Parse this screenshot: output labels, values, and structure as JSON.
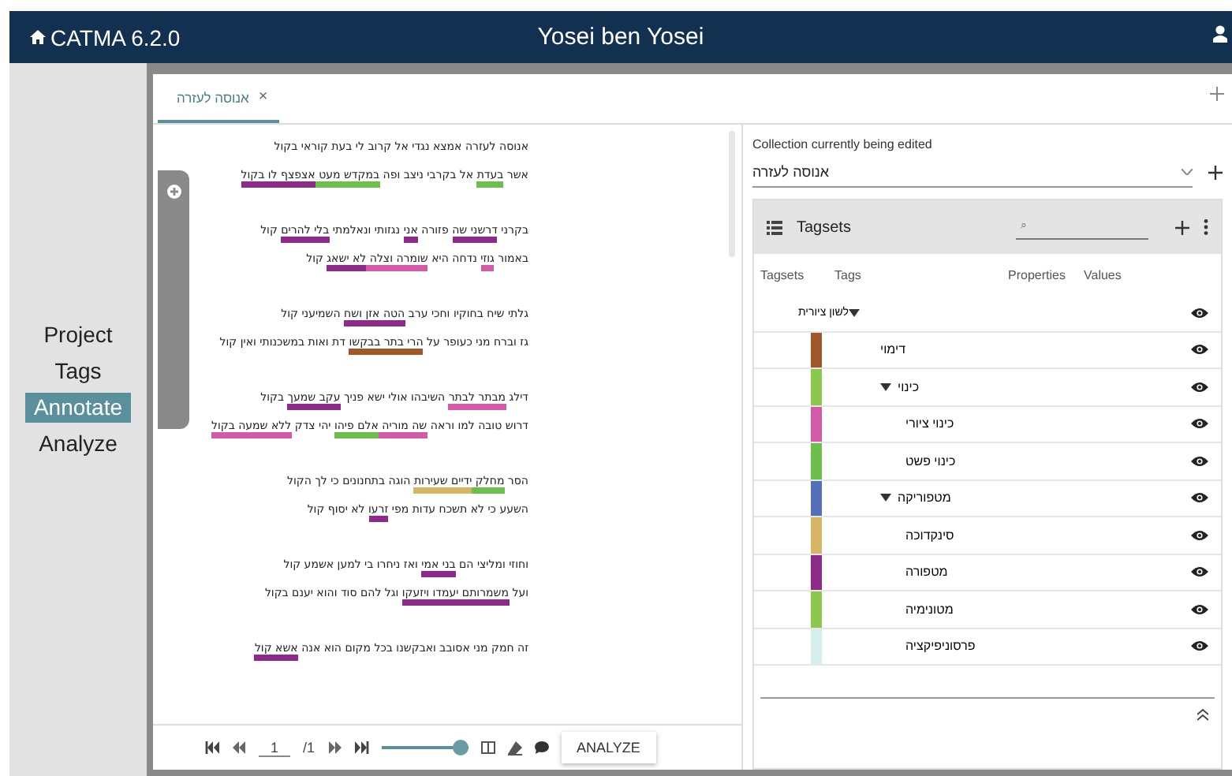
{
  "header": {
    "app": "CATMA 6.2.0",
    "user": "Yosei ben Yosei"
  },
  "nav": [
    {
      "label": "Project",
      "selected": false
    },
    {
      "label": "Tags",
      "selected": false
    },
    {
      "label": "Annotate",
      "selected": true
    },
    {
      "label": "Analyze",
      "selected": false
    }
  ],
  "tabs": [
    {
      "label": "אנוסה לעזרה",
      "close": "×",
      "selected": true
    }
  ],
  "document": {
    "stanzas": [
      [
        [
          {
            "text": "אנוסה לעזרה אמצא נגדי אל קרוב לי בעת קוראי בקול"
          }
        ],
        [
          {
            "text": "אשר "
          },
          {
            "text": "בעדת",
            "color": "#6cbf4a"
          },
          {
            "text": " אל בקרבי ניצב ופה "
          },
          {
            "text": "במקדש מעט ",
            "color": "#6cbf4a"
          },
          {
            "text": "אצפצף לו בקול",
            "color": "#8e2a8a"
          }
        ]
      ],
      [
        [
          {
            "text": "בקרני "
          },
          {
            "text": "דרשני שה",
            "color": "#8e2a8a"
          },
          {
            "text": " פזורה "
          },
          {
            "text": "אני",
            "color": "#8e2a8a"
          },
          {
            "text": " נגזותי ונאלמתי "
          },
          {
            "text": "בלי להרים",
            "color": "#8e2a8a"
          },
          {
            "text": " קול"
          }
        ],
        [
          {
            "text": "באמור "
          },
          {
            "text": "גוזי",
            "color": "#d45aa8"
          },
          {
            "text": " נדחה היא "
          },
          {
            "text": "שומרה וצלה ",
            "color": "#d45aa8"
          },
          {
            "text": "לא ישאג",
            "color": "#8e2a8a"
          },
          {
            "text": " קול"
          }
        ]
      ],
      [
        [
          {
            "text": "גלתי שיח בחוקיו וחכי ערב "
          },
          {
            "text": "הטה אזן ",
            "color": "#8e2a8a"
          },
          {
            "text": "ושח",
            "color": "#8e2a8a"
          },
          {
            "text": " השמיעני קול"
          }
        ],
        [
          {
            "text": "גז וברח מני כעופר על "
          },
          {
            "text": "הרי בתר בבקשו",
            "color": "#a0582a"
          },
          {
            "text": " דת ואות במשכנותי ואין קול"
          }
        ]
      ],
      [
        [
          {
            "text": "דילג "
          },
          {
            "text": "מבתר לבתר",
            "color": "#d45aa8"
          },
          {
            "text": " השיבהו אולי ישא פניך "
          },
          {
            "text": "עקב שמעך",
            "color": "#8e2a8a"
          },
          {
            "text": " בקול"
          }
        ],
        [
          {
            "text": "דרוש טובה למו וראה "
          },
          {
            "text": "שה מוריה ",
            "color": "#d45aa8"
          },
          {
            "text": "אלם פיהו",
            "color": "#6cbf4a"
          },
          {
            "text": " יהי צדק "
          },
          {
            "text": "ללא שמעה בקול",
            "color": "#d45aa8"
          }
        ]
      ],
      [
        [
          {
            "text": "הסר "
          },
          {
            "text": "מחלק ",
            "color": "#6cbf4a"
          },
          {
            "text": "ידיים שעירות",
            "color": "#d6b565"
          },
          {
            "text": " הוגה בתחנונים כי לך הקול"
          }
        ],
        [
          {
            "text": "השעע כי לא תשכח עדות מפי "
          },
          {
            "text": "זרעו",
            "color": "#8e2a8a"
          },
          {
            "text": " לא יסוף קול"
          }
        ]
      ],
      [
        [
          {
            "text": "וחוזי ומליצי הם "
          },
          {
            "text": "בני אמי",
            "color": "#8e2a8a"
          },
          {
            "text": " ואז ניחרו בי למען אשמע קול"
          }
        ],
        [
          {
            "text": "ועל "
          },
          {
            "text": "משמרותם יעמדו ויזעקו",
            "color": "#8e2a8a"
          },
          {
            "text": " וגל להם סוד והוא יענם בקול"
          }
        ]
      ],
      [
        [
          {
            "text": "זה חמק מני אסובב ואבקשנו בכל מקום הוא אנה "
          },
          {
            "text": "אשא קול",
            "color": "#8e2a8a"
          }
        ]
      ]
    ],
    "toolbar": {
      "page": "1",
      "total": "/1",
      "zoom": {
        "level": 1.0
      },
      "analyze": "ANALYZE"
    }
  },
  "collection": {
    "label": "Collection currently being edited",
    "value": "אנוסה לעזרה"
  },
  "tagsets": {
    "title": "Tagsets",
    "search_placeholder": "⌕",
    "columns": {
      "tagsets": "Tagsets",
      "tags": "Tags",
      "properties": "Properties",
      "values": "Values"
    },
    "tagset": {
      "name": "לשון ציורית",
      "expanded": true,
      "tags": [
        {
          "name": "דימוי",
          "color": "#a0582a"
        },
        {
          "name": "כינוי",
          "color": "#8cc84b",
          "expanded": true,
          "children": [
            {
              "name": "כינוי ציורי",
              "color": "#d45aa8"
            },
            {
              "name": "כינוי פשט",
              "color": "#6cbf4a"
            }
          ]
        },
        {
          "name": "מטפוריקה",
          "color": "#5470b8",
          "expanded": true,
          "children": [
            {
              "name": "סינקדוכה",
              "color": "#d6b565"
            },
            {
              "name": "מטפורה",
              "color": "#8e2a8a"
            },
            {
              "name": "מטונימיה",
              "color": "#8cc84b"
            },
            {
              "name": "פרסוניפיקציה",
              "color": "#d7eeee"
            }
          ]
        }
      ]
    }
  }
}
